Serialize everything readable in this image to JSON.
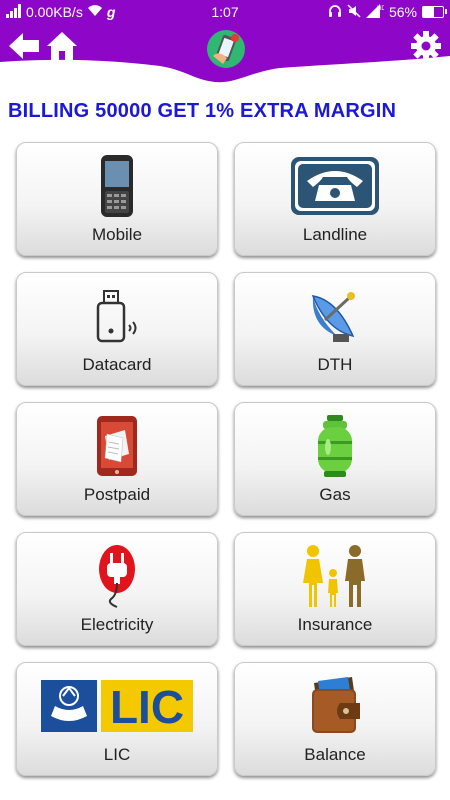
{
  "status_bar": {
    "network_speed": "0.00KB/s",
    "carrier_glyph": "g",
    "time": "1:07",
    "battery": "56%",
    "battery_level": 0.56
  },
  "header": {
    "back_icon": "back-arrow-icon",
    "home_icon": "home-icon",
    "logo_icon": "mobile-recharge-logo-icon",
    "settings_icon": "gear-icon"
  },
  "promo_text": "BILLING 50000 GET 1% EXTRA MARGIN",
  "colors": {
    "brand_purple": "#8e06c8",
    "promo_blue": "#1b18d8"
  },
  "services": [
    {
      "label": "Mobile",
      "icon": "mobile-phone-icon"
    },
    {
      "label": "Landline",
      "icon": "landline-phone-icon"
    },
    {
      "label": "Datacard",
      "icon": "datacard-icon"
    },
    {
      "label": "DTH",
      "icon": "satellite-dish-icon"
    },
    {
      "label": "Postpaid",
      "icon": "postpaid-bill-icon"
    },
    {
      "label": "Gas",
      "icon": "gas-cylinder-icon"
    },
    {
      "label": "Electricity",
      "icon": "electric-plug-icon"
    },
    {
      "label": "Insurance",
      "icon": "family-insurance-icon"
    },
    {
      "label": "LIC",
      "icon": "lic-logo-icon",
      "logo_text": "LIC"
    },
    {
      "label": "Balance",
      "icon": "wallet-icon"
    }
  ]
}
